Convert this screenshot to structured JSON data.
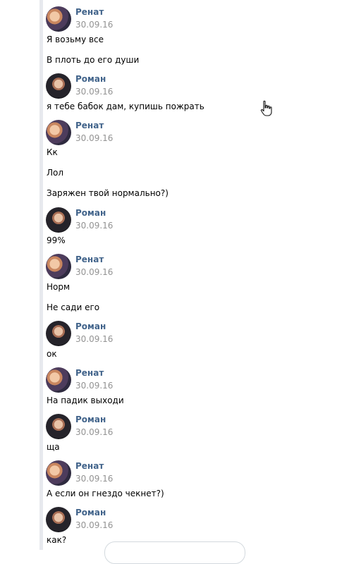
{
  "chat": {
    "m1": {
      "author": "Ренат",
      "date": "30.09.16",
      "texts": [
        "Я возьму все",
        "В плоть до его души"
      ]
    },
    "m2": {
      "author": "Роман",
      "date": "30.09.16",
      "texts": [
        "я тебе бабок дам, купишь пожрать"
      ]
    },
    "m3": {
      "author": "Ренат",
      "date": "30.09.16",
      "texts": [
        "Кк",
        "Лол",
        "Заряжен твой нормально?)"
      ]
    },
    "m4": {
      "author": "Роман",
      "date": "30.09.16",
      "texts": [
        "99%"
      ]
    },
    "m5": {
      "author": "Ренат",
      "date": "30.09.16",
      "texts": [
        "Норм",
        "Не сади его"
      ]
    },
    "m6": {
      "author": "Роман",
      "date": "30.09.16",
      "texts": [
        "ок"
      ]
    },
    "m7": {
      "author": "Ренат",
      "date": "30.09.16",
      "texts": [
        "На падик выходи"
      ]
    },
    "m8": {
      "author": "Роман",
      "date": "30.09.16",
      "texts": [
        "ща"
      ]
    },
    "m9": {
      "author": "Ренат",
      "date": "30.09.16",
      "texts": [
        "А если он гнездо чекнет?)"
      ]
    },
    "m10": {
      "author": "Роман",
      "date": "30.09.16",
      "texts": [
        "как?"
      ]
    }
  },
  "colors": {
    "author": "#42648b",
    "date": "#939393",
    "divider": "#e7e9ee"
  },
  "icons": {
    "cursor": "hand-cursor-icon"
  }
}
